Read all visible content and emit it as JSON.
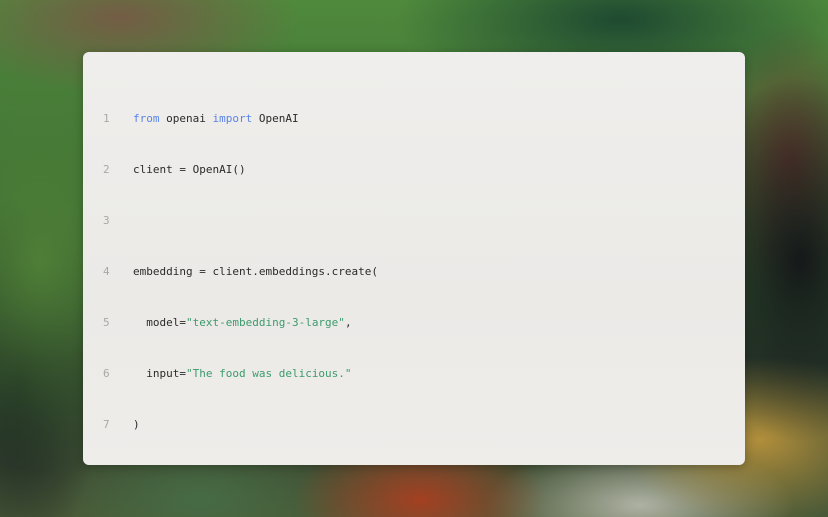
{
  "code": {
    "lines": [
      {
        "num": "1",
        "tokens": [
          {
            "text": "from",
            "type": "kw"
          },
          {
            "text": " openai ",
            "type": "plain"
          },
          {
            "text": "import",
            "type": "kw"
          },
          {
            "text": " OpenAI",
            "type": "plain"
          }
        ]
      },
      {
        "num": "2",
        "tokens": [
          {
            "text": "client = OpenAI()",
            "type": "plain"
          }
        ]
      },
      {
        "num": "3",
        "tokens": []
      },
      {
        "num": "4",
        "tokens": [
          {
            "text": "embedding = client.embeddings.create(",
            "type": "plain"
          }
        ]
      },
      {
        "num": "5",
        "tokens": [
          {
            "text": "  model=",
            "type": "plain"
          },
          {
            "text": "\"text-embedding-3-large\"",
            "type": "str"
          },
          {
            "text": ",",
            "type": "plain"
          }
        ]
      },
      {
        "num": "6",
        "tokens": [
          {
            "text": "  input=",
            "type": "plain"
          },
          {
            "text": "\"The food was delicious.\"",
            "type": "str"
          }
        ]
      },
      {
        "num": "7",
        "tokens": [
          {
            "text": ")",
            "type": "plain"
          }
        ]
      }
    ]
  },
  "colors": {
    "keyword": "#5b84e6",
    "string": "#3d9a6c",
    "line_number": "#a8a8a5",
    "text": "#2a2a2a",
    "card_background": "#eeede9"
  }
}
